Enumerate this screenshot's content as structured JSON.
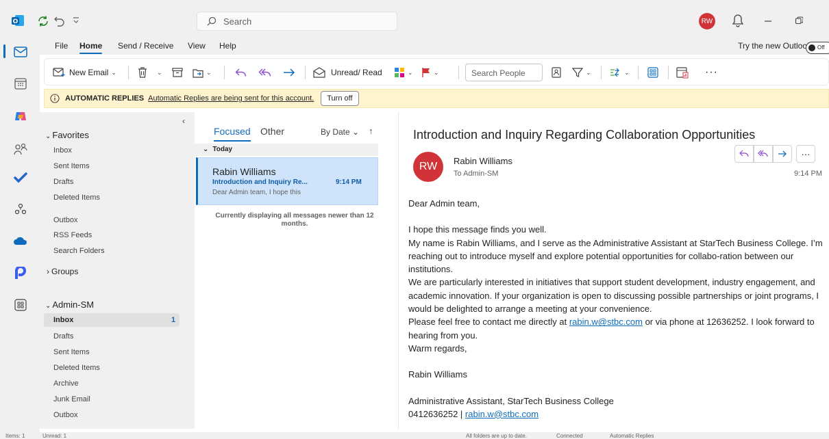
{
  "titlebar": {
    "search_placeholder": "Search",
    "avatar_initials": "RW"
  },
  "menu": {
    "tabs": [
      "File",
      "Home",
      "Send / Receive",
      "View",
      "Help"
    ],
    "active_tab": "Home",
    "try_new": "Try the new Outlook",
    "toggle_label": "Off"
  },
  "ribbon": {
    "new_email": "New Email",
    "unread_read": "Unread/ Read",
    "search_people": "Search People"
  },
  "infobar": {
    "title": "AUTOMATIC REPLIES",
    "message": "Automatic Replies are being sent for this account.",
    "button": "Turn off"
  },
  "folders": {
    "favorites_label": "Favorites",
    "favorites": [
      "Inbox",
      "Sent Items",
      "Drafts",
      "Deleted Items"
    ],
    "other": [
      "Outbox",
      "RSS Feeds",
      "Search Folders"
    ],
    "groups_label": "Groups",
    "account_label": "Admin-SM",
    "account_folders": [
      "Inbox",
      "Drafts",
      "Sent Items",
      "Deleted Items",
      "Archive",
      "Junk Email",
      "Outbox"
    ],
    "inbox_unread": "1"
  },
  "list": {
    "tab_focused": "Focused",
    "tab_other": "Other",
    "sort": "By Date",
    "group": "Today",
    "item": {
      "sender": "Rabin Williams",
      "subject": "Introduction and Inquiry Re...",
      "time": "9:14 PM",
      "preview": "Dear Admin team, I hope this"
    },
    "note": "Currently displaying all messages newer than 12 months."
  },
  "reading": {
    "subject": "Introduction and Inquiry Regarding Collaboration Opportunities",
    "avatar_initials": "RW",
    "sender": "Rabin Williams",
    "to": "To  Admin-SM",
    "time": "9:14 PM",
    "greeting": "Dear Admin team,",
    "line1": "I hope this message finds you well.",
    "para1": "My name is Rabin Williams, and I serve as the Administrative Assistant at StarTech Business College. I’m reaching out to introduce myself and explore potential opportunities for collabo-ration between our institutions.",
    "para2": "We are particularly interested in initiatives that support student development, industry engagement, and academic innovation. If your organization is open to discussing possible partnerships or joint programs, I would be delighted to arrange a meeting at your convenience.",
    "para3_pre": "Please feel free to contact me directly at ",
    "email": "rabin.w@stbc.com",
    "para3_post": " or via phone at 12636252. I look forward to hearing from you.",
    "closing": "Warm regards,",
    "sig_name": "Rabin Williams",
    "sig_title": "Administrative Assistant, StarTech Business College",
    "sig_phone": "0412636252  |  ",
    "sig_email": "rabin.w@stbc.com"
  },
  "status": {
    "items": "Items: 1",
    "unread": "Unread: 1",
    "sync": "All folders are up to date.",
    "connection": "Connected",
    "auto_replies": "Automatic Replies"
  },
  "colors": {
    "accent": "#0f6cbd",
    "avatar": "#d13438",
    "infobar": "#fff4ce",
    "selected_item": "#cfe4fa"
  }
}
